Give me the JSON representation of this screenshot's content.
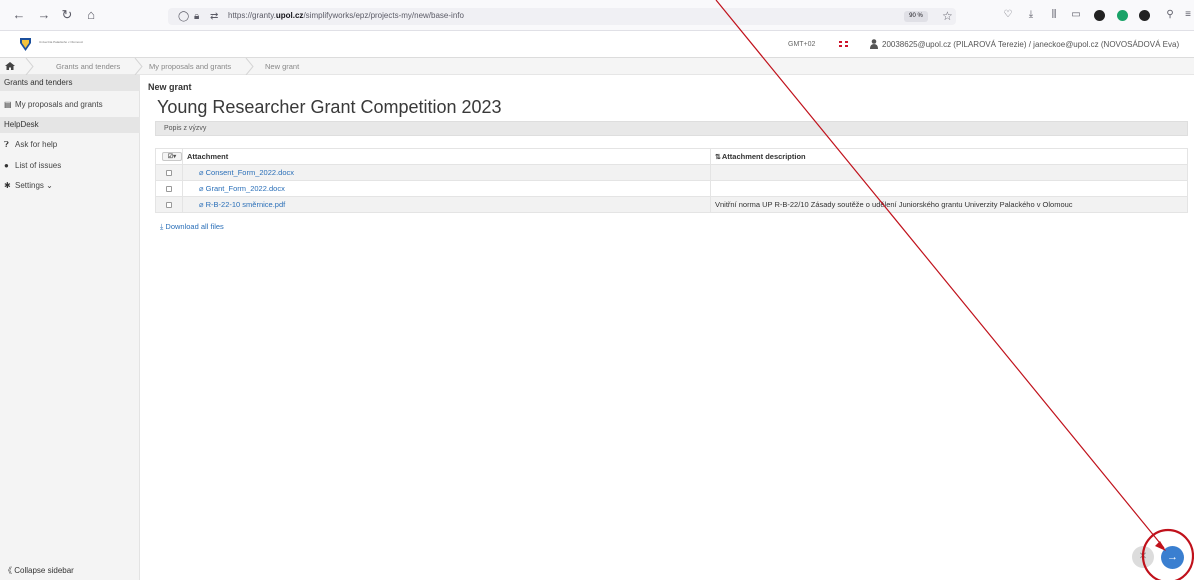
{
  "browser": {
    "url_prefix": "https://granty.",
    "url_domain": "upol.cz",
    "url_path": "/simplifyworks/epz/projects-my/new/base-info",
    "zoom": "90 %"
  },
  "header": {
    "logo_text": "Univerzita Palackého v Olomouci",
    "timezone": "GMT+02",
    "user": "20038625@upol.cz (PILAROVÁ Terezie) / janeckoe@upol.cz (NOVOSÁDOVÁ Eva)"
  },
  "breadcrumb": {
    "items": [
      "Grants and tenders",
      "My proposals and grants",
      "New grant"
    ]
  },
  "sidebar": {
    "section1": "Grants and tenders",
    "item1": "My proposals and grants",
    "section2": "HelpDesk",
    "item2": "Ask for help",
    "item3": "List of issues",
    "item4": "Settings",
    "collapse": "Collapse sidebar"
  },
  "main": {
    "subtitle": "New grant",
    "title": "Young Researcher Grant Competition 2023",
    "popis": "Popis z výzvy",
    "table": {
      "col_file": "Attachment",
      "col_desc": "Attachment description",
      "rows": [
        {
          "file": "Consent_Form_2022.docx",
          "desc": ""
        },
        {
          "file": "Grant_Form_2022.docx",
          "desc": ""
        },
        {
          "file": "R-B-22-10 směrnice.pdf",
          "desc": "Vnitřní norma UP R-B-22/10 Zásady soutěže o udělení Juniorského grantu Univerzity Palackého v Olomouc"
        }
      ]
    },
    "download_all": "Download all files"
  },
  "colors": {
    "link": "#2a6fb8",
    "annotation": "#c0111b",
    "next_button": "#3a7fd0"
  }
}
